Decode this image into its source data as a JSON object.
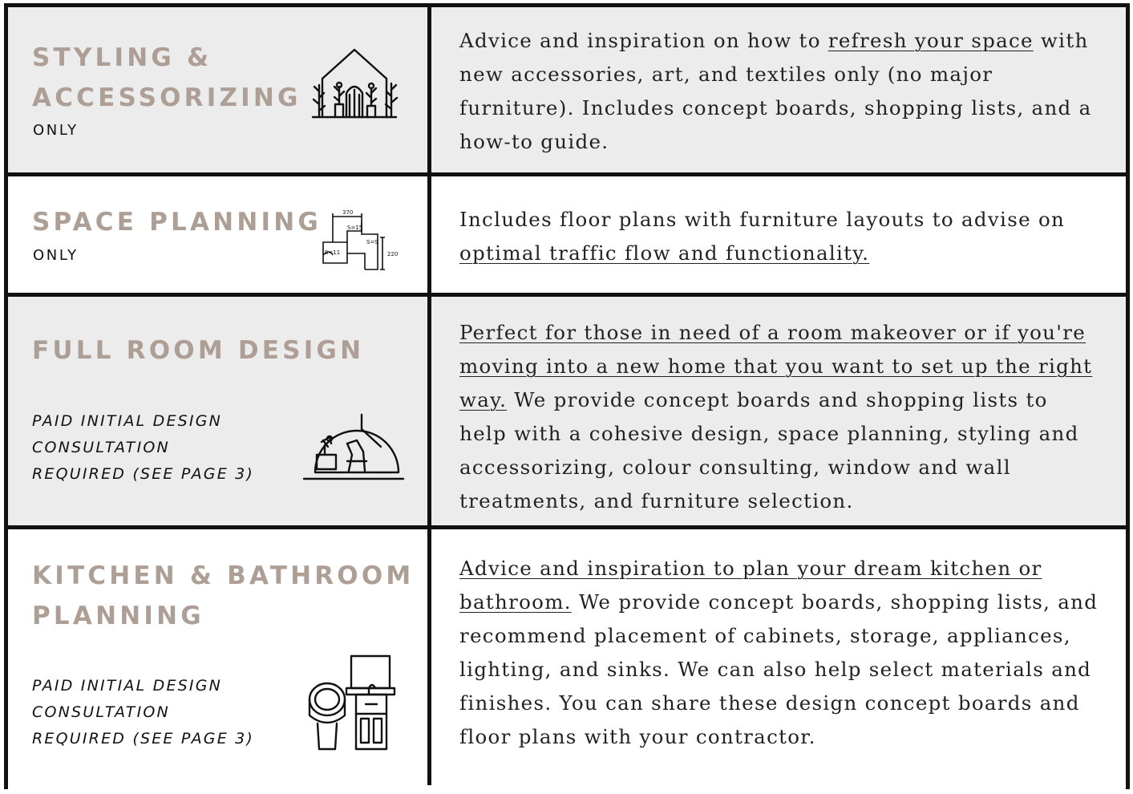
{
  "rows": [
    {
      "title_line1": "STYLING &",
      "title_line2": "ACCESSORIZING",
      "qualifier": "ONLY",
      "icon": "house-plants-icon",
      "desc_pre": "Advice and inspiration on how to ",
      "desc_link": "refresh your space",
      "desc_post": " with new accessories, art, and textiles only (no major furniture). Includes concept boards, shopping lists, and a how-to guide."
    },
    {
      "title_line1": "SPACE PLANNING",
      "qualifier": "ONLY",
      "icon": "floor-plan-icon",
      "plan_labels": [
        "370",
        "S=15",
        "S=9",
        "S=11",
        "220"
      ],
      "desc_pre": "Includes floor plans with furniture layouts to advise on ",
      "desc_link": "optimal traffic flow and functionality."
    },
    {
      "title_line1": "FULL ROOM DESIGN",
      "note_lines": [
        "PAID INITIAL DESIGN",
        "CONSULTATION",
        "REQUIRED (SEE PAGE 3)"
      ],
      "icon": "room-chair-icon",
      "desc_link": "Perfect for those in need of a room makeover or if you're moving into a new home that you want to set up the right way.",
      "desc_post": " We provide concept boards and shopping lists to help with a cohesive design, space planning, styling and accessorizing, colour consulting, window and wall treatments, and furniture selection."
    },
    {
      "title_line1": "KITCHEN & BATHROOM",
      "title_line2": "PLANNING",
      "note_lines": [
        "PAID INITIAL DESIGN",
        "CONSULTATION",
        "REQUIRED (SEE PAGE 3)"
      ],
      "icon": "bathroom-toilet-vanity-icon",
      "desc_link": "Advice and inspiration to plan your dream kitchen or bathroom.",
      "desc_post": " We provide concept boards, shopping lists, and recommend placement of cabinets, storage, appliances, lighting, and sinks. We can also help select materials and finishes. You can share these design concept boards and floor plans with your contractor."
    }
  ],
  "colors": {
    "title": "#ad9f95",
    "shaded_row": "#ececec",
    "border": "#111111"
  }
}
